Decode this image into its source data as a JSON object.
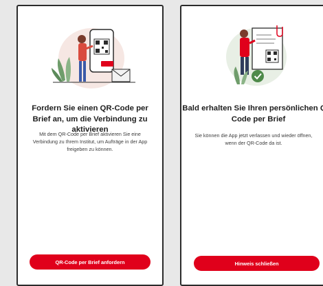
{
  "screens": [
    {
      "headline": "Fordern Sie einen QR-Code per Brief an, um die Verbindung zu aktivieren",
      "body": "Mit dem QR-Code per Brief aktivieren Sie eine Verbindung zu Ihrem Institut, um Aufträge in der App freigeben zu können.",
      "button": "QR-Code per Brief anfordern",
      "illustration": "woman-phone-qr-letter-illustration"
    },
    {
      "headline": "Bald erhalten Sie Ihren persönlichen QR-Code per Brief",
      "body": "Sie können die App jetzt verlassen und wieder öffnen, wenn der QR-Code da ist.",
      "button": "Hinweis schließen",
      "illustration": "man-letter-qr-check-illustration"
    }
  ],
  "colors": {
    "accent": "#e0001b",
    "text": "#1e1e1e"
  }
}
